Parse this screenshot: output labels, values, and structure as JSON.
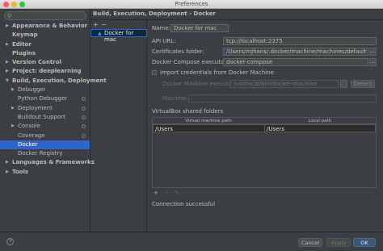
{
  "window": {
    "title": "Preferences"
  },
  "search": {
    "icon": "search-icon",
    "value": ""
  },
  "tree": [
    {
      "label": "Appearance & Behavior",
      "bold": true,
      "arrow": "right",
      "indent": 0
    },
    {
      "label": "Keymap",
      "bold": true,
      "arrow": "",
      "indent": 0
    },
    {
      "label": "Editor",
      "bold": true,
      "arrow": "right",
      "indent": 0
    },
    {
      "label": "Plugins",
      "bold": true,
      "arrow": "",
      "indent": 0
    },
    {
      "label": "Version Control",
      "bold": true,
      "arrow": "right",
      "indent": 0
    },
    {
      "label": "Project: deeplearning",
      "bold": true,
      "arrow": "right",
      "indent": 0
    },
    {
      "label": "Build, Execution, Deployment",
      "bold": true,
      "arrow": "down",
      "indent": 0
    },
    {
      "label": "Debugger",
      "bold": false,
      "arrow": "right",
      "indent": 1
    },
    {
      "label": "Python Debugger",
      "bold": false,
      "arrow": "",
      "indent": 1,
      "gear": true
    },
    {
      "label": "Deployment",
      "bold": false,
      "arrow": "right",
      "indent": 1,
      "gear": true
    },
    {
      "label": "Buildout Support",
      "bold": false,
      "arrow": "",
      "indent": 1,
      "gear": true
    },
    {
      "label": "Console",
      "bold": false,
      "arrow": "right",
      "indent": 1,
      "gear": true
    },
    {
      "label": "Coverage",
      "bold": false,
      "arrow": "",
      "indent": 1,
      "gear": true
    },
    {
      "label": "Docker",
      "bold": false,
      "arrow": "",
      "indent": 1,
      "selected": true
    },
    {
      "label": "Docker Registry",
      "bold": false,
      "arrow": "",
      "indent": 1
    },
    {
      "label": "Languages & Frameworks",
      "bold": true,
      "arrow": "right",
      "indent": 0
    },
    {
      "label": "Tools",
      "bold": true,
      "arrow": "right",
      "indent": 0
    }
  ],
  "breadcrumb": "Build, Execution, Deployment › Docker",
  "list": {
    "add": "+",
    "remove": "−",
    "item": "Docker for mac"
  },
  "form": {
    "name_label": "Name:",
    "name_value": "Docker for mac",
    "api_label": "API URL:",
    "api_value": "tcp://localhost:2375",
    "certs_label": "Certificates folder:",
    "certs_value": "/Users/mjhans/.docker/machine/machines/default",
    "compose_label": "Docker Compose executable:",
    "compose_value": "docker-compose",
    "import_label": "Import credentials from Docker Machine",
    "machine_exec_label": "Docker Machine executable:",
    "machine_exec_value": "/usr/local/bin/docker-machine",
    "detect_label": "Detect",
    "machine_label": "Machine:",
    "machine_value": ""
  },
  "shared": {
    "title": "VirtualBox shared folders",
    "col_vm": "Virtual machine path",
    "col_local": "Local path",
    "rows": [
      {
        "vm": "/Users",
        "local": "/Users"
      }
    ]
  },
  "table_tools": {
    "add": "+",
    "remove": "−",
    "edit": "✎"
  },
  "status": "Connection successful",
  "buttons": {
    "help": "?",
    "cancel": "Cancel",
    "apply": "Apply",
    "ok": "OK"
  },
  "colors": {
    "selection": "#2f65ca",
    "ok_button": "#365880",
    "background": "#3c3f41"
  }
}
